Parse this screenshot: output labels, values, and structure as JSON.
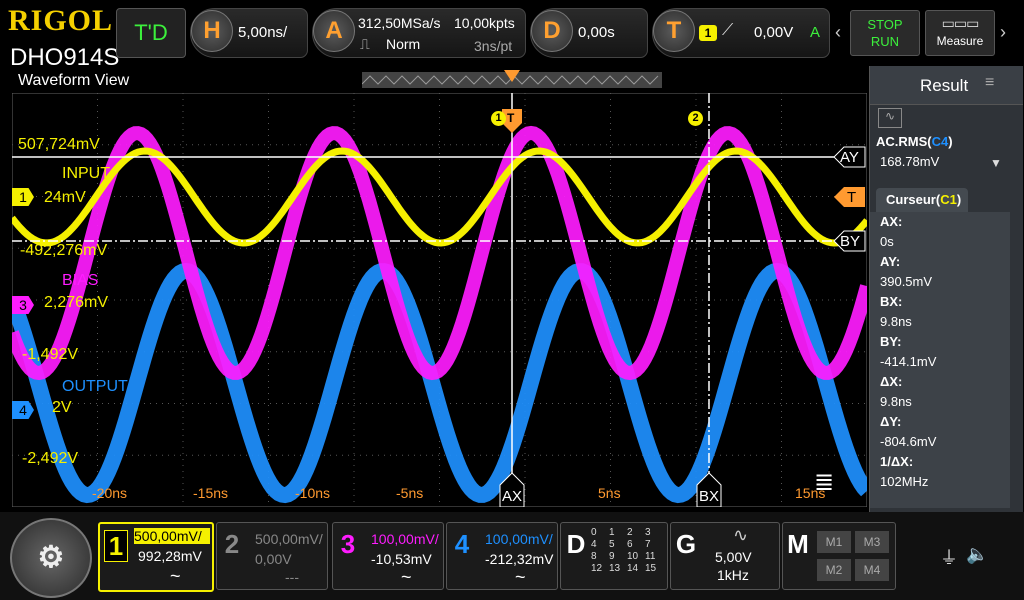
{
  "brand": {
    "logo": "RIGOL",
    "model": "DHO914S",
    "view_title": "Waveform View"
  },
  "topbar": {
    "td_label": "T'D",
    "horizontal": {
      "badge": "H",
      "value": "5,00ns/"
    },
    "acquire": {
      "badge": "A",
      "sample_rate": "312,50MSa/s",
      "mode": "Norm",
      "points": "10,00kpts",
      "resolution": "3ns/pt"
    },
    "delay": {
      "badge": "D",
      "value": "0,00s"
    },
    "trigger": {
      "badge": "T",
      "source": "1",
      "level": "0,00V",
      "mode": "A"
    },
    "stop_label": "STOP",
    "run_label": "RUN",
    "measure_label": "Measure"
  },
  "plot": {
    "x_ticks": [
      "-20ns",
      "-15ns",
      "-10ns",
      "-5ns",
      "5ns",
      "15ns"
    ],
    "cursor_labels": {
      "ay": "AY",
      "by": "BY",
      "ax": "AX",
      "bx": "BX"
    },
    "trigger_tag": "T",
    "ch1": {
      "tag": "1",
      "name": "INPUT",
      "top_value": "507,724mV",
      "offset_value": "24mV",
      "bottom_value": "-492,276mV"
    },
    "ch3": {
      "tag": "3",
      "name": "BIAS",
      "offset_value": "2,276mV",
      "bottom_value": "-1,492V"
    },
    "ch4": {
      "tag": "4",
      "name": "OUTPUT",
      "offset_value": "2V",
      "bottom_value": "-2,492V"
    },
    "markers": {
      "m1": "1",
      "m2": "2"
    }
  },
  "result": {
    "title": "Result",
    "meas_label": "AC.RMS(",
    "meas_src": "C4",
    "meas_close": ")",
    "meas_value": "168.78mV",
    "cursor_tab": "Curseur(",
    "cursor_src": "C1",
    "cursor_close": ")",
    "items": [
      {
        "label": "AX:",
        "value": "0s"
      },
      {
        "label": "AY:",
        "value": "390.5mV"
      },
      {
        "label": "BX:",
        "value": "9.8ns"
      },
      {
        "label": "BY:",
        "value": "-414.1mV"
      },
      {
        "label": "ΔX:",
        "value": "9.8ns"
      },
      {
        "label": "ΔY:",
        "value": "-804.6mV"
      },
      {
        "label": "1/ΔX:",
        "value": "102MHz"
      }
    ]
  },
  "bottombar": {
    "ch1": {
      "num": "1",
      "scale": "500,00mV/",
      "offset": "992,28mV",
      "coupling": "~"
    },
    "ch2": {
      "num": "2",
      "scale": "500,00mV/",
      "offset": "0,00V",
      "coupling": "---"
    },
    "ch3": {
      "num": "3",
      "scale": "100,00mV/",
      "offset": "-10,53mV",
      "coupling": "~"
    },
    "ch4": {
      "num": "4",
      "scale": "100,00mV/",
      "offset": "-212,32mV",
      "coupling": "~"
    },
    "digital": {
      "label": "D",
      "channels": [
        "0",
        "1",
        "2",
        "3",
        "4",
        "5",
        "6",
        "7",
        "8",
        "9",
        "10",
        "11",
        "12",
        "13",
        "14",
        "15"
      ]
    },
    "generator": {
      "label": "G",
      "amplitude": "5,00V",
      "frequency": "1kHz"
    },
    "math": {
      "label": "M",
      "slots": [
        "M1",
        "M3",
        "M2",
        "M4"
      ]
    }
  },
  "colors": {
    "ch1": "#f5f000",
    "ch2": "#888888",
    "ch3": "#ff1cff",
    "ch4": "#1e90ff",
    "accent": "#ff9a30",
    "green": "#3cf03c"
  }
}
